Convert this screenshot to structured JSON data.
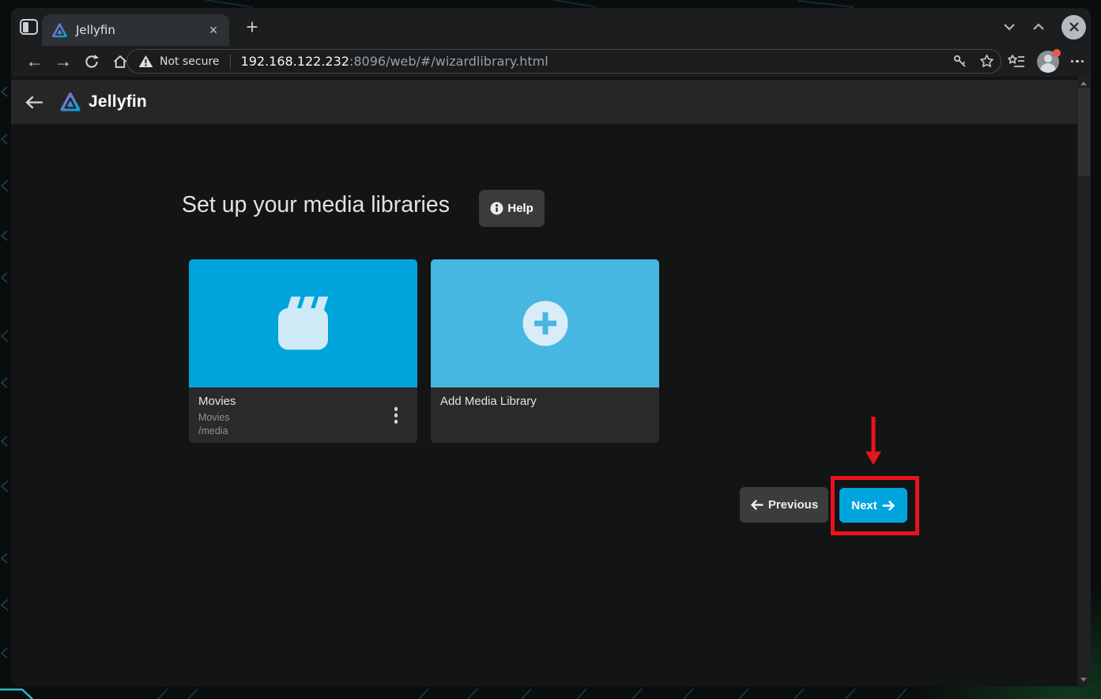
{
  "window": {
    "tab_title": "Jellyfin",
    "close_glyph": "×",
    "new_tab_glyph": "+"
  },
  "browser": {
    "security_label": "Not secure",
    "url_host": "192.168.122.232",
    "url_rest": ":8096/web/#/wizardlibrary.html"
  },
  "app": {
    "brand": "Jellyfin",
    "heading": "Set up your media libraries",
    "help_label": "Help",
    "libraries": [
      {
        "title": "Movies",
        "subtitle": "Movies",
        "path": "/media"
      },
      {
        "title": "Add Media Library"
      }
    ],
    "nav": {
      "previous_label": "Previous",
      "next_label": "Next"
    }
  },
  "colors": {
    "accent": "#00a4dc",
    "add_card": "#47b6e0",
    "annotation": "#e8131c"
  }
}
